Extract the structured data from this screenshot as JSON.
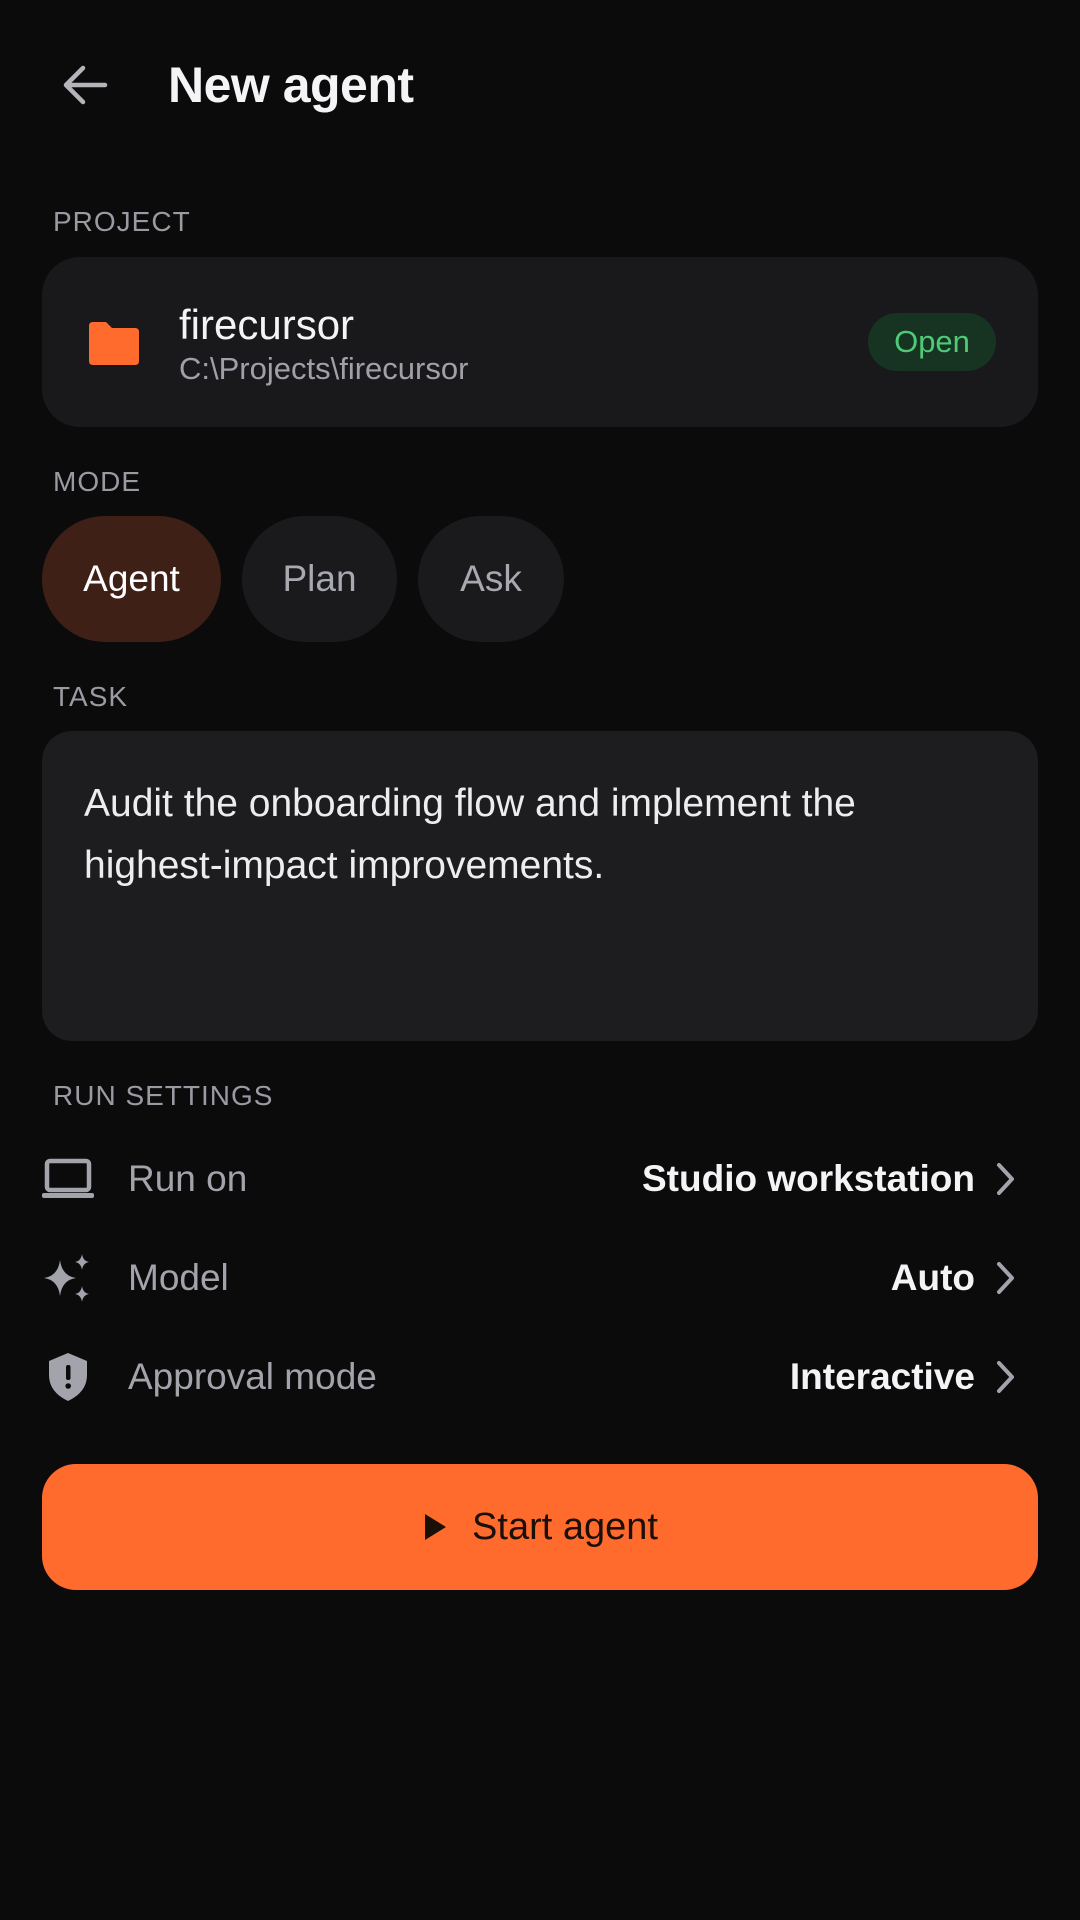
{
  "header": {
    "title": "New agent",
    "back_icon": "arrow-left-icon"
  },
  "project": {
    "section_label": "PROJECT",
    "name": "firecursor",
    "path": "C:\\Projects\\firecursor",
    "status": "Open",
    "icon": "folder-icon",
    "icon_color": "#ff6b2c"
  },
  "mode": {
    "section_label": "MODE",
    "options": [
      {
        "label": "Agent",
        "selected": true
      },
      {
        "label": "Plan",
        "selected": false
      },
      {
        "label": "Ask",
        "selected": false
      }
    ]
  },
  "task": {
    "section_label": "TASK",
    "value": "Audit the onboarding flow and implement the highest-impact improvements."
  },
  "run_settings": {
    "section_label": "RUN SETTINGS",
    "items": [
      {
        "label": "Run on",
        "value": "Studio workstation",
        "icon": "laptop-icon"
      },
      {
        "label": "Model",
        "value": "Auto",
        "icon": "sparkle-icon"
      },
      {
        "label": "Approval mode",
        "value": "Interactive",
        "icon": "shield-icon"
      }
    ]
  },
  "start_button": {
    "label": "Start agent",
    "icon": "play-icon"
  },
  "colors": {
    "accent": "#ff6b2c",
    "background": "#0b0b0c",
    "card": "#19191c",
    "success": "#4ecb77",
    "selected_pill": "#3f2016"
  }
}
